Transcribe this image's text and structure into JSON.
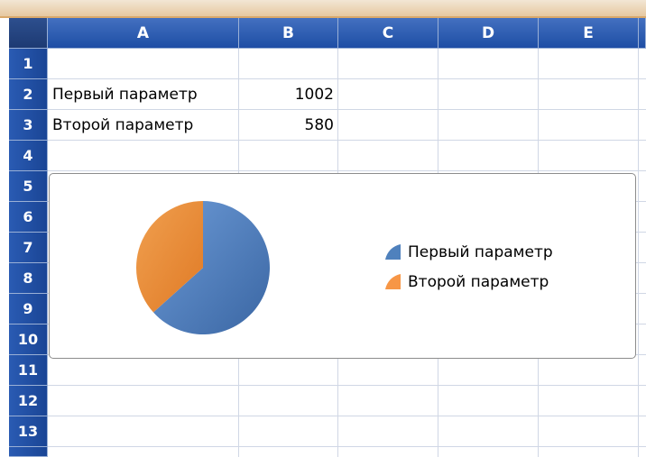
{
  "columns": [
    "A",
    "B",
    "C",
    "D",
    "E"
  ],
  "rows": [
    "1",
    "2",
    "3",
    "4",
    "5",
    "6",
    "7",
    "8",
    "9",
    "10",
    "11",
    "12",
    "13"
  ],
  "cells": [
    {
      "ref": "A2",
      "value": "Первый параметр"
    },
    {
      "ref": "B2",
      "value": "1002"
    },
    {
      "ref": "A3",
      "value": "Второй параметр"
    },
    {
      "ref": "B3",
      "value": "580"
    }
  ],
  "colors": {
    "series1": "#4f81bd",
    "series2": "#f79646",
    "header_blue": "#1e4ea5"
  },
  "chart_data": {
    "type": "pie",
    "categories": [
      "Первый параметр",
      "Второй параметр"
    ],
    "values": [
      1002,
      580
    ],
    "colors": [
      "#4f81bd",
      "#f79646"
    ],
    "legend": "right"
  }
}
